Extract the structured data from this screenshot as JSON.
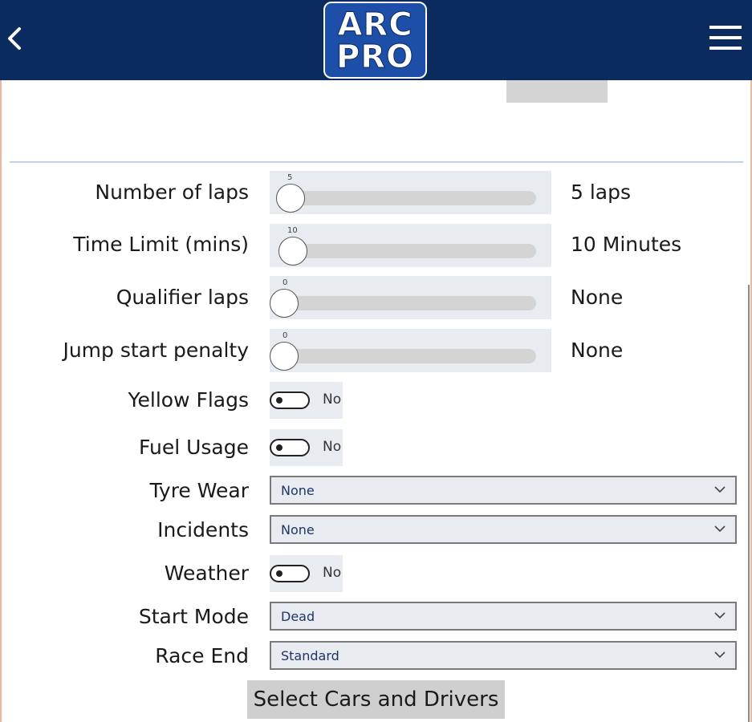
{
  "header": {
    "logo_line1": "ARC",
    "logo_line2": "PRO",
    "background": "#0b2a5e"
  },
  "sliders": [
    {
      "label": "Number of laps",
      "tick": "5",
      "value_text": "5 laps",
      "value": 5
    },
    {
      "label": "Time Limit (mins)",
      "tick": "10",
      "value_text": "10 Minutes",
      "value": 10
    },
    {
      "label": "Qualifier laps",
      "tick": "0",
      "value_text": "None",
      "value": 0
    },
    {
      "label": "Jump start penalty",
      "tick": "0",
      "value_text": "None",
      "value": 0
    }
  ],
  "toggles": {
    "yellow_flags": {
      "label": "Yellow Flags",
      "state_text": "No",
      "on": false
    },
    "fuel_usage": {
      "label": "Fuel Usage",
      "state_text": "No",
      "on": false
    },
    "weather": {
      "label": "Weather",
      "state_text": "No",
      "on": false
    }
  },
  "selects": {
    "tyre_wear": {
      "label": "Tyre Wear",
      "value": "None"
    },
    "incidents": {
      "label": "Incidents",
      "value": "None"
    },
    "start_mode": {
      "label": "Start Mode",
      "value": "Dead"
    },
    "race_end": {
      "label": "Race End",
      "value": "Standard"
    }
  },
  "actions": {
    "select_cars_label": "Select Cars and Drivers"
  }
}
